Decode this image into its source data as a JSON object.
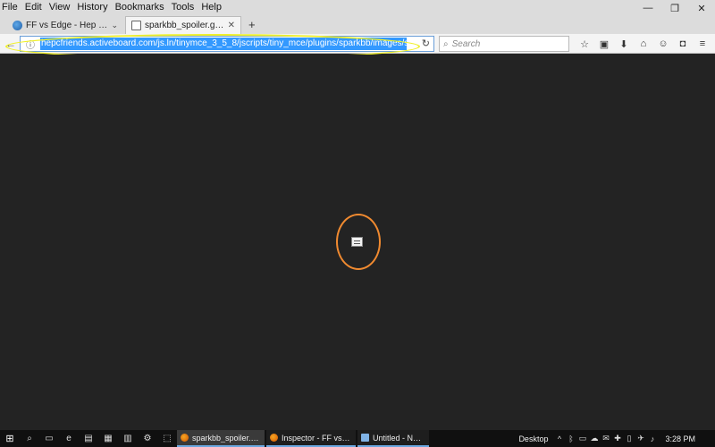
{
  "menubar": {
    "items": [
      "File",
      "Edit",
      "View",
      "History",
      "Bookmarks",
      "Tools",
      "Help"
    ]
  },
  "window_controls": {
    "minimize": "—",
    "restore": "❐",
    "close": "✕"
  },
  "tabs": [
    {
      "label": "FF vs Edge - Hep C Discus…",
      "dropdown": "⌄"
    },
    {
      "label": "sparkbb_spoiler.gif (GIF Ima…",
      "close": "✕"
    }
  ],
  "new_tab": "+",
  "navbar": {
    "back": "←",
    "info": "ⓘ",
    "url": "hepcfriends.activeboard.com/js.ln/tinymce_3_5_8/jscripts/tiny_mce/plugins/sparkbb/images/sparkbb_spoile",
    "reload": "↻",
    "search_placeholder": "Search",
    "search_icon": "⌕"
  },
  "toolbar": {
    "icons": [
      "☆",
      "▣",
      "⬇",
      "⌂",
      "☺",
      "◘",
      "≡"
    ],
    "icon_names": [
      "bookmark-star-icon",
      "reading-list-icon",
      "download-icon",
      "home-icon",
      "hello-icon",
      "pocket-icon",
      "menu-icon"
    ]
  },
  "taskbar": {
    "start": "⊞",
    "pins": [
      "⌕",
      "▭",
      "e",
      "▤",
      "▦",
      "▥",
      "⚙",
      "⬚"
    ],
    "pin_names": [
      "search-icon",
      "task-view-icon",
      "edge-icon",
      "file-explorer-icon",
      "calendar-icon",
      "calculator-icon",
      "settings-icon",
      "app-icon"
    ],
    "tasks": [
      {
        "label": "sparkbb_spoiler.gif (G…",
        "active": true
      },
      {
        "label": "Inspector - FF vs Edge…",
        "active": false
      },
      {
        "label": "Untitled - Notepad",
        "active": false
      }
    ],
    "tray_label": "Desktop",
    "tray_icons": [
      "^",
      "ᛒ",
      "▭",
      "☁",
      "✉",
      "✚",
      "▯",
      "✈",
      "♪"
    ],
    "tray_names": [
      "show-hidden-icon",
      "bluetooth-icon",
      "battery-icon",
      "onedrive-icon",
      "mail-icon",
      "security-icon",
      "network-icon",
      "airplane-icon",
      "volume-icon"
    ],
    "clock": "3:28 PM"
  },
  "colors": {
    "content_bg": "#232323",
    "url_highlight": "#f0f028",
    "image_highlight": "#f08a30",
    "selection": "#3399ff"
  }
}
